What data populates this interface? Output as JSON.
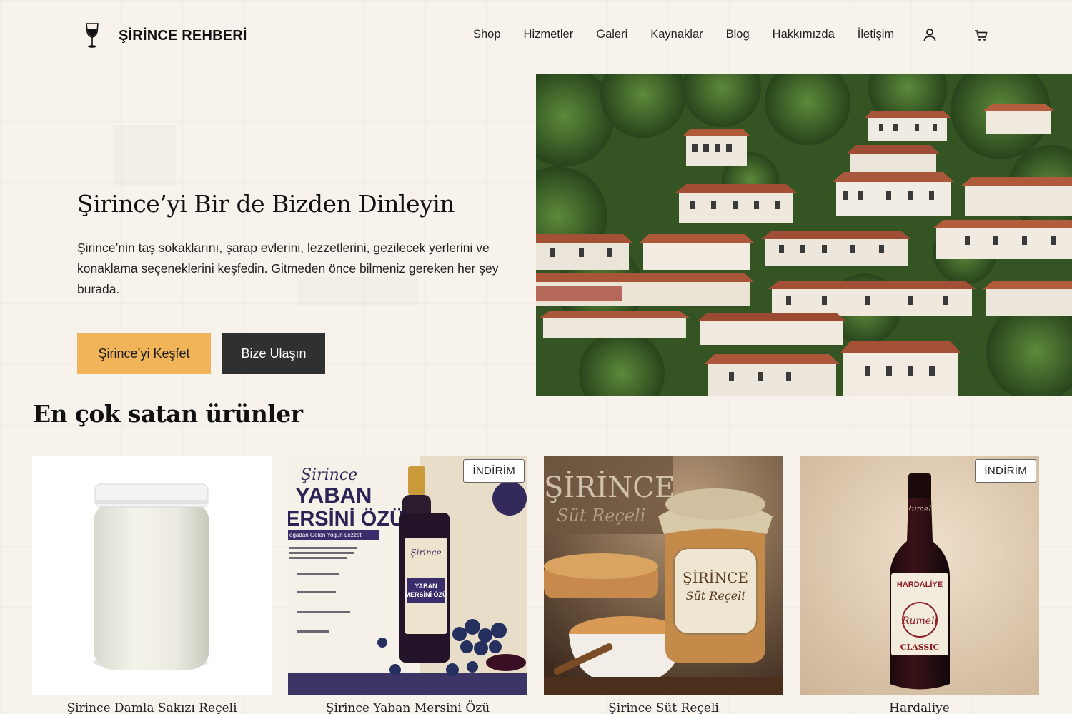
{
  "brand": {
    "name": "ŞİRİNCE REHBERİ",
    "icon": "wine-glass-icon"
  },
  "nav": {
    "items": [
      "Shop",
      "Hizmetler",
      "Galeri",
      "Kaynaklar",
      "Blog",
      "Hakkımızda",
      "İletişim"
    ],
    "account_icon": "user-icon",
    "cart_icon": "cart-icon"
  },
  "hero": {
    "title": "Şirince’yi Bir de Bizden Dinleyin",
    "text": "Şirince’nin taş sokaklarını, şarap evlerini, lezzetlerini, gezilecek yerlerini ve konaklama seçeneklerini keşfedin. Gitmeden önce bilmeniz gereken her şey burada.",
    "primary_button": "Şirince’yi Keşfet",
    "secondary_button": "Bize Ulaşın",
    "image": "village-hillside-photo"
  },
  "bestsellers": {
    "title": "En çok satan ürünler",
    "products": [
      {
        "name": "Şirince Damla Sakızı Reçeli",
        "badge": ""
      },
      {
        "name": "Şirince Yaban Mersini Özü",
        "badge": "İNDİRİM"
      },
      {
        "name": "Şirince Süt Reçeli",
        "badge": ""
      },
      {
        "name": "Hardaliye",
        "badge": "İNDİRİM"
      }
    ],
    "product_image_text": {
      "p2_brand": "Şirince",
      "p2_line1": "YABAN",
      "p2_line2": "ERSİNİ ÖZÜ",
      "p2_tagline": "oğadan Gelen Yoğun Lezzet",
      "p3_line1": "ŞİRİNCE",
      "p3_line2": "Süt Reçeli",
      "p4_line1": "HARDALİYE",
      "p4_line2": "Rumeli",
      "p4_line3": "CLASSIC"
    }
  },
  "colors": {
    "background": "#f7f3ec",
    "accent": "#f1b458",
    "dark": "#2f3030"
  }
}
